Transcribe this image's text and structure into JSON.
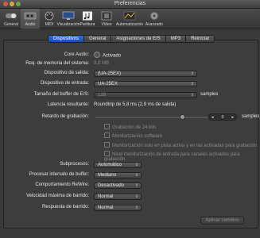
{
  "window": {
    "title": "Preferencias"
  },
  "toolbar": {
    "items": [
      {
        "label": "General",
        "icon": "toggle-switch-icon"
      },
      {
        "label": "Audio",
        "icon": "audio-interface-icon"
      },
      {
        "label": "MIDI",
        "icon": "midi-connector-icon"
      },
      {
        "label": "Visualización",
        "icon": "monitor-icon"
      },
      {
        "label": "Partitura",
        "icon": "sheet-music-icon"
      },
      {
        "label": "Vídeo",
        "icon": "film-icon"
      },
      {
        "label": "Automatización",
        "icon": "automation-curve-icon"
      },
      {
        "label": "Avanzado",
        "icon": "gear-icon"
      }
    ],
    "active_index": 1
  },
  "tabs": [
    {
      "label": "Dispositivos",
      "active": true
    },
    {
      "label": "General",
      "active": false
    },
    {
      "label": "Asignaciones de E/S",
      "active": false
    },
    {
      "label": "MP3",
      "active": false
    },
    {
      "label": "Reiniciar",
      "active": false
    }
  ],
  "form": {
    "core_audio_label": "Core Audio:",
    "core_audio_value": "Activado",
    "mem_label": "Req. de memoria del sistema:",
    "mem_value": "8,0 MB",
    "output_label": "Dispositivo de salida:",
    "output_value": "(UA-25EX)",
    "input_label": "Dispositivo de entrada:",
    "input_value": "UA-25EX",
    "buffer_label": "Tamaño del buffer de E/S:",
    "buffer_value": "128",
    "buffer_unit": "samples",
    "latency_label": "Latencia resultante:",
    "latency_value": "Roundtrip de 5,8 ms (2,9 ms de salida)",
    "delay_label": "Retardo de grabación:",
    "delay_value": "0",
    "delay_unit": "samples",
    "cb_24bit": "Grabación de 24 bits",
    "cb_software": "Monitorización software",
    "cb_active_only": "Monitorización solo en pista activa y en las activadas para grabación",
    "cb_level": "Nivel monitorización de entrada para canales activados para grabación",
    "subprocess_label": "Subprocesos:",
    "subprocess_value": "Automático",
    "process_buffer_label": "Procesar intervalo de buffer:",
    "process_buffer_value": "Mediano",
    "rewire_label": "Comportamiento ReWire:",
    "rewire_value": "Desactivado",
    "max_scrub_label": "Velocidad máxima de barrido:",
    "max_scrub_value": "Normal",
    "scrub_resp_label": "Respuesta de barrido:",
    "scrub_resp_value": "Normal"
  },
  "buttons": {
    "apply": "Aplicar cambios"
  }
}
